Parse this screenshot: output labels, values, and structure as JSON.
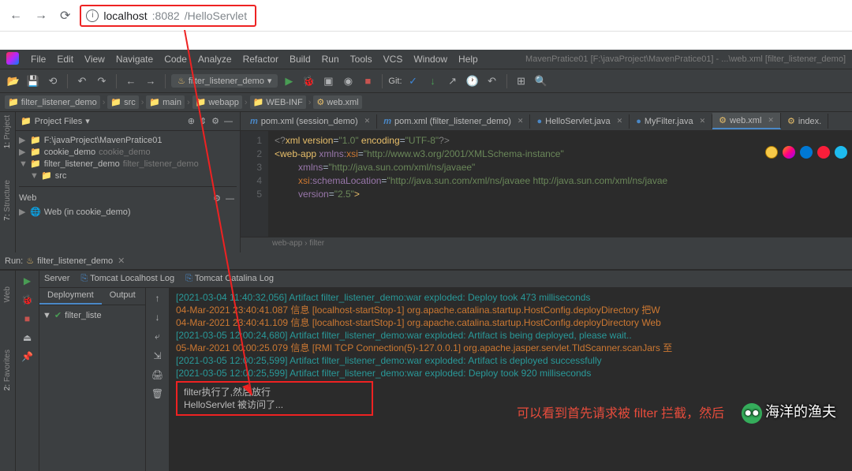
{
  "browser": {
    "url_host": "localhost",
    "url_port": ":8082",
    "url_path": "/HelloServlet"
  },
  "ij": {
    "title_path": "MavenPratice01 [F:\\javaProject\\MavenPratice01] - ...\\web.xml [filter_listener_demo]",
    "menu": [
      "File",
      "Edit",
      "View",
      "Navigate",
      "Code",
      "Analyze",
      "Refactor",
      "Build",
      "Run",
      "Tools",
      "VCS",
      "Window",
      "Help"
    ],
    "run_config": "filter_listener_demo",
    "git_label": "Git:",
    "breadcrumb": [
      "filter_listener_demo",
      "src",
      "main",
      "webapp",
      "WEB-INF",
      "web.xml"
    ],
    "project": {
      "header": "Project Files",
      "rows": [
        {
          "indent": 0,
          "arrow": "▶",
          "label": "F:\\javaProject\\MavenPratice01"
        },
        {
          "indent": 0,
          "arrow": "▶",
          "label": "cookie_demo",
          "muted": "cookie_demo"
        },
        {
          "indent": 0,
          "arrow": "▼",
          "label": "filter_listener_demo",
          "muted": "filter_listener_demo"
        },
        {
          "indent": 1,
          "arrow": "▼",
          "label": "src"
        }
      ],
      "web_header": "Web",
      "web_row": "Web (in cookie_demo)"
    },
    "tabs": [
      {
        "icon": "m",
        "label": "pom.xml (session_demo)",
        "active": false
      },
      {
        "icon": "m",
        "label": "pom.xml (filter_listener_demo)",
        "active": false
      },
      {
        "icon": "j",
        "label": "HelloServlet.java",
        "active": false
      },
      {
        "icon": "j",
        "label": "MyFilter.java",
        "active": false
      },
      {
        "icon": "w",
        "label": "web.xml",
        "active": true
      },
      {
        "icon": "w",
        "label": "index.",
        "active": false
      }
    ],
    "code": {
      "lines": [
        "1",
        "2",
        "3",
        "4",
        "5"
      ],
      "l1_a": "<?",
      "l1_b": "xml version",
      "l1_c": "=",
      "l1_d": "\"1.0\"",
      "l1_e": " encoding",
      "l1_f": "=",
      "l1_g": "\"UTF-8\"",
      "l1_h": "?>",
      "l2_a": "<",
      "l2_b": "web-app ",
      "l2_c": "xmlns:",
      "l2_d": "xsi",
      "l2_e": "=",
      "l2_f": "\"http://www.w3.org/2001/XMLSchema-instance\"",
      "l3_a": "xmlns",
      "l3_b": "=",
      "l3_c": "\"http://java.sun.com/xml/ns/javaee\"",
      "l4_a": "xsi",
      "l4_b": ":",
      "l4_c": "schemaLocation",
      "l4_d": "=",
      "l4_e": "\"http://java.sun.com/xml/ns/javaee http://java.sun.com/xml/ns/javae",
      "l5_a": "version",
      "l5_b": "=",
      "l5_c": "\"2.5\"",
      "l5_d": ">",
      "crumb": "web-app  ›  filter"
    },
    "run": {
      "header": "filter_listener_demo",
      "ext_tabs": [
        "Server",
        "Tomcat Localhost Log",
        "Tomcat Catalina Log"
      ],
      "mid_tabs": [
        "Deployment",
        "Output"
      ],
      "deploy_item": "filter_liste",
      "log": [
        {
          "c": "teal",
          "t": "[2021-03-04 11:40:32,056] Artifact filter_listener_demo:war exploded: Deploy took 473 milliseconds"
        },
        {
          "c": "or",
          "t": "04-Mar-2021 23:40:41.087 信息 [localhost-startStop-1] org.apache.catalina.startup.HostConfig.deployDirectory 把W"
        },
        {
          "c": "or",
          "t": "04-Mar-2021 23:40:41.109 信息 [localhost-startStop-1] org.apache.catalina.startup.HostConfig.deployDirectory Web"
        },
        {
          "c": "teal",
          "t": "[2021-03-05 12:00:24,680] Artifact filter_listener_demo:war exploded: Artifact is being deployed, please wait.."
        },
        {
          "c": "or",
          "t": "05-Mar-2021 00:00:25.079 信息 [RMI TCP Connection(5)-127.0.0.1] org.apache.jasper.servlet.TldScanner.scanJars 至"
        },
        {
          "c": "teal",
          "t": "[2021-03-05 12:00:25,599] Artifact filter_listener_demo:war exploded: Artifact is deployed successfully"
        },
        {
          "c": "teal",
          "t": "[2021-03-05 12:00:25,599] Artifact filter_listener_demo:war exploded: Deploy took 920 milliseconds"
        }
      ],
      "box1": "filter执行了,然后放行",
      "box2": "HelloServlet 被访问了...",
      "red_note": "可以看到首先请求被 filter 拦截，然后"
    },
    "vtabs": [
      {
        "num": "1:",
        "label": "Project"
      },
      {
        "num": "7:",
        "label": "Structure"
      }
    ],
    "vtabs2": [
      {
        "num": "",
        "label": "Web"
      },
      {
        "num": "2:",
        "label": "Favorites"
      }
    ],
    "runlabel": "Run:"
  },
  "watermark": "海洋的渔夫"
}
